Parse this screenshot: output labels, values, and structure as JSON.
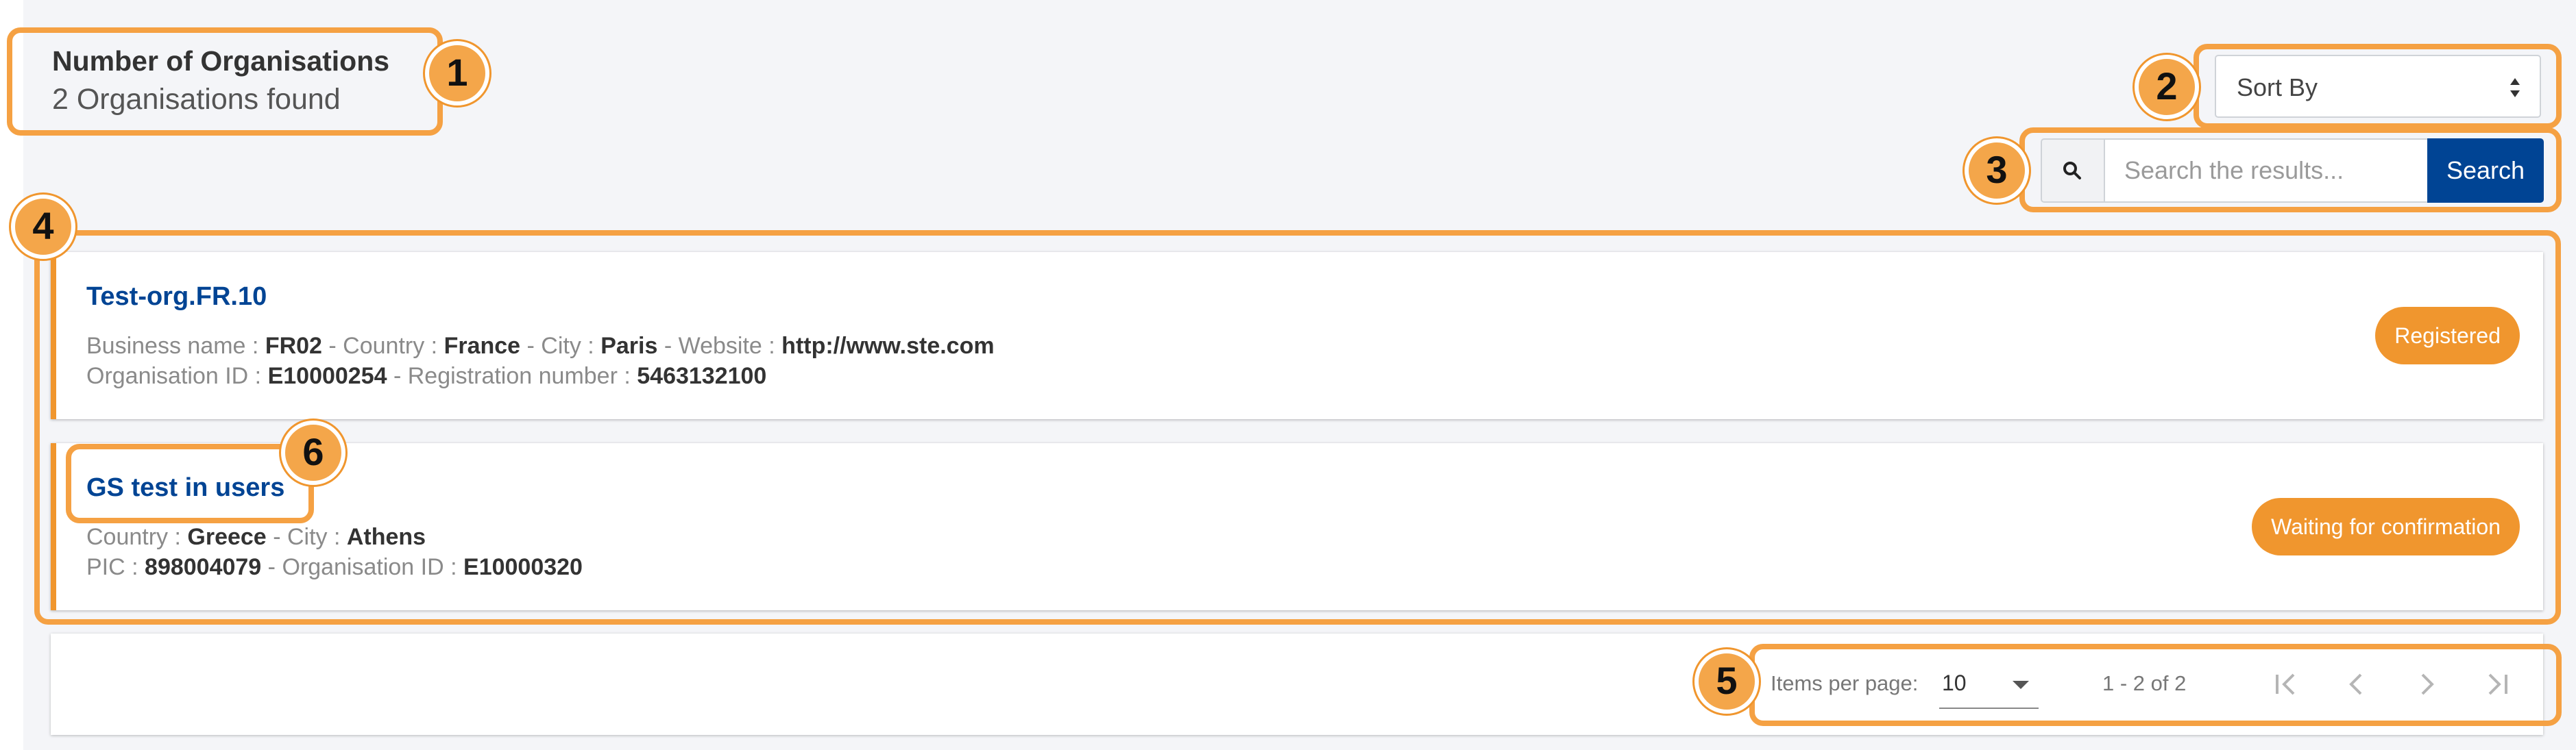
{
  "header": {
    "title": "Number of Organisations",
    "count_text": "2 Organisations found"
  },
  "sort": {
    "label": "Sort By"
  },
  "search": {
    "placeholder": "Search the results...",
    "button_label": "Search"
  },
  "organisations": [
    {
      "name": "Test-org.FR.10",
      "status": "Registered",
      "lines": [
        [
          {
            "label": "Business name :",
            "value": "FR02"
          },
          {
            "label": "- Country :",
            "value": "France"
          },
          {
            "label": "- City :",
            "value": "Paris"
          },
          {
            "label": "- Website :",
            "value": "http://www.ste.com"
          }
        ],
        [
          {
            "label": "Organisation ID :",
            "value": "E10000254"
          },
          {
            "label": "- Registration number :",
            "value": "5463132100"
          }
        ]
      ]
    },
    {
      "name": "GS test in users",
      "status": "Waiting for confirmation",
      "lines": [
        [
          {
            "label": "Country :",
            "value": "Greece"
          },
          {
            "label": "- City :",
            "value": "Athens"
          }
        ],
        [
          {
            "label": "PIC :",
            "value": "898004079"
          },
          {
            "label": "- Organisation ID :",
            "value": "E10000320"
          }
        ]
      ]
    }
  ],
  "pagination": {
    "items_per_page_label": "Items per page:",
    "items_per_page_value": "10",
    "range_text": "1 - 2 of 2"
  },
  "callouts": [
    "1",
    "2",
    "3",
    "4",
    "5",
    "6"
  ],
  "colors": {
    "accent": "#f0962e",
    "brand_blue": "#004494",
    "callout_border": "#f5a143"
  }
}
